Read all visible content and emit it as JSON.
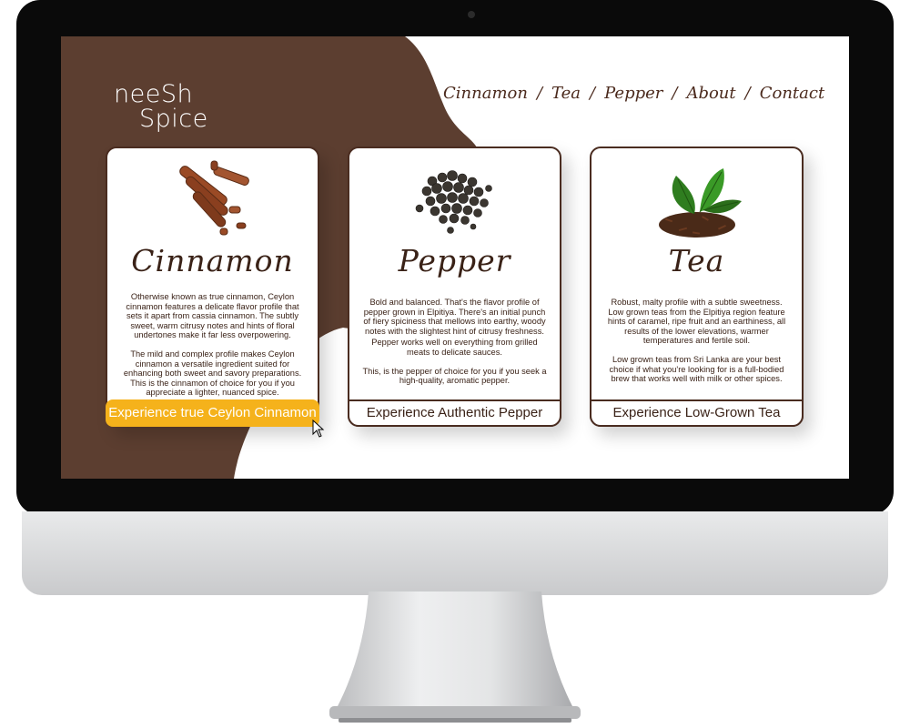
{
  "brand": {
    "logo_text": "neeShSpice",
    "logo_part1": "neeSh",
    "logo_part2": "Spice"
  },
  "colors": {
    "brown": "#5c3e30",
    "accent": "#f5b21b",
    "dark_text": "#3a2217",
    "white": "#ffffff"
  },
  "nav": {
    "items": [
      "Cinnamon",
      "Tea",
      "Pepper",
      "About",
      "Contact"
    ],
    "separator": "/"
  },
  "cards": [
    {
      "title": "Cinnamon",
      "image_icon": "cinnamon-sticks-icon",
      "body": [
        "Otherwise known as true cinnamon, Ceylon cinnamon features a delicate flavor profile that sets it apart from cassia cinnamon. The subtly sweet, warm citrusy notes and hints of floral undertones make it far less overpowering.",
        "The mild and complex profile makes Ceylon cinnamon a versatile ingredient suited for enhancing both sweet and savory preparations. This is the cinnamon of choice for you if you appreciate a lighter, nuanced spice."
      ],
      "button": "Experience true Ceylon Cinnamon"
    },
    {
      "title": "Pepper",
      "image_icon": "peppercorns-icon",
      "body": [
        "Bold and balanced. That's the flavor profile of pepper grown in Elpitiya. There's an initial punch of fiery spiciness that mellows into earthy, woody notes with the slightest hint of citrusy freshness.",
        "Pepper works well on everything from grilled meats to delicate sauces.",
        "This, is the pepper of choice for you if you seek a high-quality, aromatic pepper."
      ],
      "button": "Experience Authentic Pepper"
    },
    {
      "title": "Tea",
      "image_icon": "tea-leaves-icon",
      "body": [
        "Robust, malty profile with a subtle sweetness. Low grown teas from the Elpitiya region feature hints of caramel, ripe fruit and an earthiness, all results of the lower elevations, warmer temperatures and fertile soil.",
        "Low grown teas from Sri Lanka are your best choice if what you're looking for is a full-bodied brew that works well with milk or other spices."
      ],
      "button": "Experience Low-Grown Tea"
    }
  ]
}
